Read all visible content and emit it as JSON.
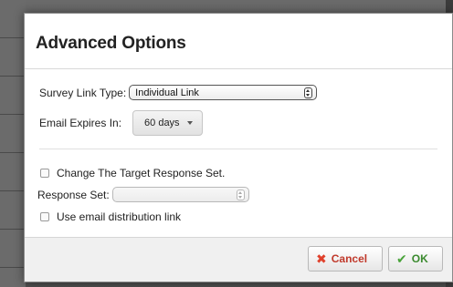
{
  "dialog": {
    "title": "Advanced Options"
  },
  "survey_link": {
    "label": "Survey Link Type:",
    "value": "Individual Link"
  },
  "email_expires": {
    "label": "Email Expires In:",
    "value": "60 days"
  },
  "change_target": {
    "label": "Change The Target Response Set.",
    "checked": false
  },
  "response_set": {
    "label": "Response Set:",
    "value": ""
  },
  "use_email_distribution": {
    "label": "Use email distribution link",
    "checked": false
  },
  "footer": {
    "cancel_label": "Cancel",
    "ok_label": "OK"
  },
  "colors": {
    "cancel_text": "#c0392b",
    "ok_text": "#3a8a2e",
    "cancel_icon": "#e0412c",
    "ok_icon": "#49a33a"
  },
  "icons": {
    "cancel": "x-icon",
    "ok": "checkmark-icon",
    "select_stepper": "up-down-stepper-icon",
    "dropdown": "caret-down-icon"
  }
}
